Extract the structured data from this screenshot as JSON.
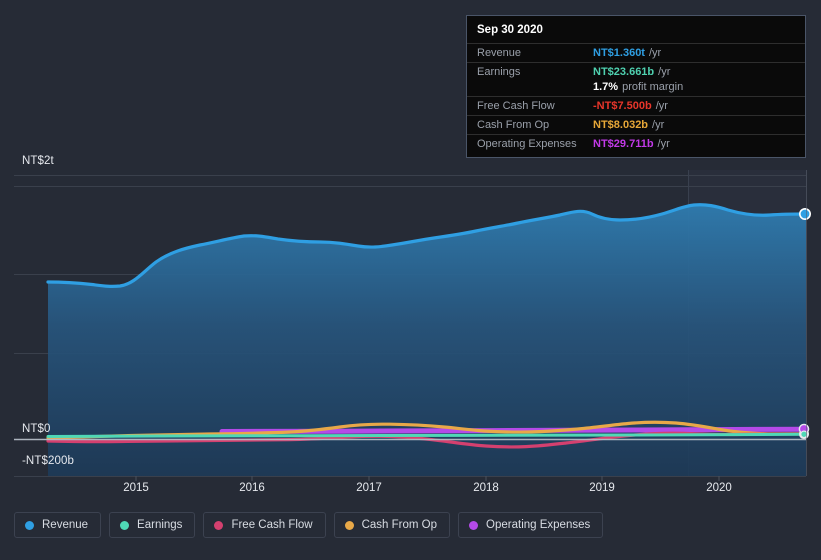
{
  "chart_data": {
    "type": "area",
    "title": "",
    "xlabel": "",
    "ylabel": "",
    "currency": "NT$",
    "grid": true,
    "legend_position": "bottom",
    "x_ticks": [
      "2015",
      "2016",
      "2017",
      "2018",
      "2019",
      "2020"
    ],
    "y_ticks": [
      "NT$2t",
      "NT$0",
      "-NT$200b"
    ],
    "ylim": [
      -200000000000,
      2000000000000
    ],
    "xlim": [
      "2014-06",
      "2021-03"
    ],
    "forecast_divider_x": "2020-01",
    "series": [
      {
        "name": "Revenue",
        "color": "#2f9fe3",
        "filled": true,
        "x": [
          "2014-06",
          "2014-12",
          "2015-06",
          "2015-09",
          "2016-03",
          "2016-09",
          "2017-03",
          "2017-09",
          "2018-03",
          "2018-09",
          "2019-03",
          "2019-09",
          "2020-03",
          "2020-09"
        ],
        "values": [
          0.86,
          0.84,
          1.0,
          1.06,
          1.03,
          1.06,
          1.02,
          1.06,
          1.1,
          1.22,
          1.28,
          1.31,
          1.28,
          1.36
        ],
        "units": "NT$ trillions",
        "endpoint_value": 1.36
      },
      {
        "name": "Earnings",
        "color": "#4fd8b6",
        "filled": false,
        "x": [
          "2014-06",
          "2015-06",
          "2016-06",
          "2017-06",
          "2018-06",
          "2019-06",
          "2020-09"
        ],
        "values": [
          0.01,
          0.012,
          0.014,
          0.016,
          0.013,
          0.015,
          0.0237
        ],
        "units": "NT$ trillions",
        "endpoint_value": 0.0237
      },
      {
        "name": "Free Cash Flow",
        "color": "#d4406f",
        "filled": false,
        "x": [
          "2014-06",
          "2015-06",
          "2016-06",
          "2017-03",
          "2017-09",
          "2018-03",
          "2018-09",
          "2019-06",
          "2020-03",
          "2020-09"
        ],
        "values": [
          -0.018,
          -0.012,
          -0.01,
          -0.016,
          -0.012,
          -0.03,
          -0.022,
          -0.014,
          -0.006,
          -0.0075
        ],
        "units": "NT$ trillions",
        "endpoint_value": -0.0075
      },
      {
        "name": "Cash From Op",
        "color": "#e8a848",
        "filled": false,
        "x": [
          "2014-06",
          "2015-06",
          "2016-06",
          "2017-03",
          "2017-09",
          "2018-06",
          "2019-06",
          "2020-03",
          "2020-09"
        ],
        "values": [
          0.006,
          0.01,
          0.012,
          0.03,
          0.024,
          0.016,
          0.02,
          0.044,
          0.008
        ],
        "units": "NT$ trillions",
        "endpoint_value": 0.008
      },
      {
        "name": "Operating Expenses",
        "color": "#b44ae8",
        "filled": false,
        "x": [
          "2015-09",
          "2016-06",
          "2017-06",
          "2018-06",
          "2019-06",
          "2020-09"
        ],
        "values": [
          0.022,
          0.022,
          0.024,
          0.024,
          0.026,
          0.0297
        ],
        "units": "NT$ trillions",
        "endpoint_value": 0.0297
      }
    ]
  },
  "tooltip": {
    "date": "Sep 30 2020",
    "rows": [
      {
        "label": "Revenue",
        "value": "NT$1.360t",
        "suffix": "/yr",
        "color": "#2f9fe3"
      },
      {
        "label": "Earnings",
        "value": "NT$23.661b",
        "suffix": "/yr",
        "color": "#4fd1b0"
      },
      {
        "label": "",
        "value": "1.7%",
        "suffix": "profit margin",
        "color": "#ffffff"
      },
      {
        "label": "Free Cash Flow",
        "value": "-NT$7.500b",
        "suffix": "/yr",
        "color": "#e8362b"
      },
      {
        "label": "Cash From Op",
        "value": "NT$8.032b",
        "suffix": "/yr",
        "color": "#e8a838"
      },
      {
        "label": "Operating Expenses",
        "value": "NT$29.711b",
        "suffix": "/yr",
        "color": "#c23ae8"
      }
    ]
  },
  "legend": {
    "items": [
      {
        "label": "Revenue",
        "color": "#2f9fe3"
      },
      {
        "label": "Earnings",
        "color": "#4fd8b6"
      },
      {
        "label": "Free Cash Flow",
        "color": "#d4406f"
      },
      {
        "label": "Cash From Op",
        "color": "#e8a848"
      },
      {
        "label": "Operating Expenses",
        "color": "#b44ae8"
      }
    ]
  },
  "axis": {
    "y_top": "NT$2t",
    "y_zero": "NT$0",
    "y_negative": "-NT$200b",
    "x_2015": "2015",
    "x_2016": "2016",
    "x_2017": "2017",
    "x_2018": "2018",
    "x_2019": "2019",
    "x_2020": "2020"
  }
}
